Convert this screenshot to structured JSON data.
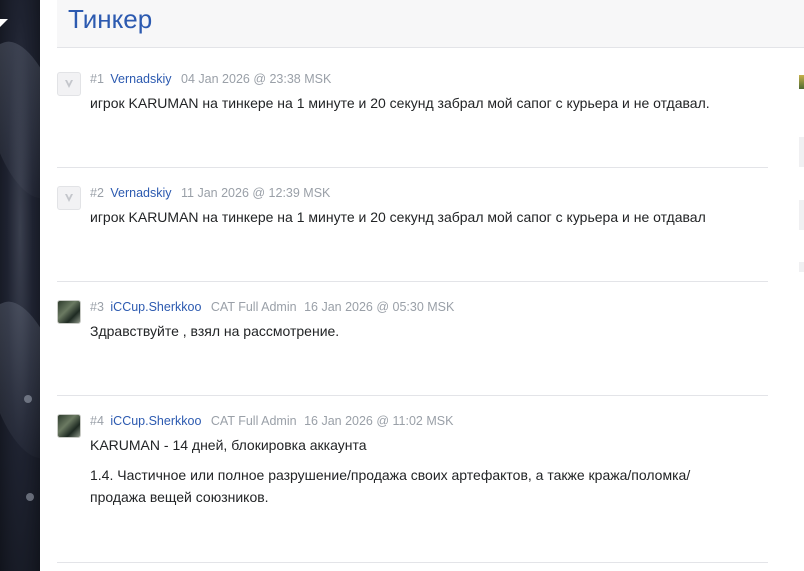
{
  "topic": {
    "title": "Тинкер"
  },
  "posts": [
    {
      "num": "#1",
      "author": "Vernadskiy",
      "role": "",
      "date": "04 Jan 2026 @ 23:38 MSK",
      "avatar": "default-avatar-icon",
      "lines": [
        "игрок KARUMAN на тинкере на 1 минуте и 20 секунд забрал мой сапог с курьера и не отдавал."
      ]
    },
    {
      "num": "#2",
      "author": "Vernadskiy",
      "role": "",
      "date": "11 Jan 2026 @ 12:39 MSK",
      "avatar": "default-avatar-icon",
      "lines": [
        "игрок KARUMAN на тинкере на 1 минуте и 20 секунд забрал мой сапог с курьера и не отдавал"
      ]
    },
    {
      "num": "#3",
      "author": "iCCup.Sherkkoo",
      "role": "CAT Full Admin",
      "date": "16 Jan 2026 @ 05:30 MSK",
      "avatar": "user-avatar-image",
      "lines": [
        "Здравствуйте , взял на рассмотрение."
      ]
    },
    {
      "num": "#4",
      "author": "iCCup.Sherkkoo",
      "role": "CAT Full Admin",
      "date": "16 Jan 2026 @ 11:02 MSK",
      "avatar": "user-avatar-image",
      "lines": [
        "KARUMAN - 14 дней, блокировка аккаунта",
        "1.4. Частичное или полное разрушение/продажа своих артефактов, а также кража/поломка/ продажа вещей союзников."
      ]
    }
  ],
  "colors": {
    "link": "#2c5ab0",
    "meta": "#9aa0a8",
    "text": "#222426",
    "divider": "#e3e4e8"
  }
}
